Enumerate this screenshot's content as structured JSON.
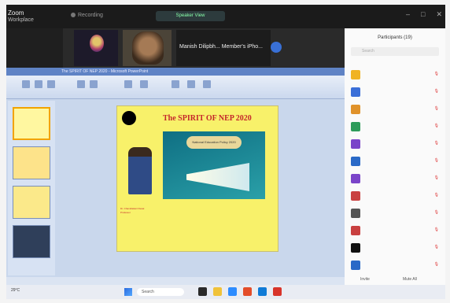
{
  "topbar": {
    "app_line1": "Zoom",
    "app_line2": "Workplace",
    "recording": "Recording",
    "meeting_title": "Speaker View"
  },
  "videos": {
    "tile1_name": "",
    "tile2_name": "",
    "tile3_name": "Manish Dilipbh... Member's iPho..."
  },
  "powerpoint": {
    "titlebar": "The SPIRIT OF NEP 2020 - Microsoft PowerPoint",
    "slide_heading": "The SPIRIT OF NEP 2020",
    "art_label": "National Education Policy 2020",
    "footer_lines": [
      "Dr. Chandrakant Desai",
      "Professor"
    ]
  },
  "participants": {
    "title": "Participants (19)",
    "search_placeholder": "Search",
    "rows": [
      {
        "name": "",
        "color": "#f0b323"
      },
      {
        "name": "",
        "color": "#3b6fd8"
      },
      {
        "name": "",
        "color": "#e0922a"
      },
      {
        "name": "",
        "color": "#2d9b5a"
      },
      {
        "name": "",
        "color": "#7a44c9"
      },
      {
        "name": "",
        "color": "#2a69c7"
      },
      {
        "name": "",
        "color": "#7a44c9"
      },
      {
        "name": "",
        "color": "#c94040"
      },
      {
        "name": "",
        "color": "#555555"
      },
      {
        "name": "",
        "color": "#c94040"
      },
      {
        "name": "",
        "color": "#111111"
      },
      {
        "name": "",
        "color": "#2a69c7"
      }
    ],
    "invite": "Invite",
    "mute_all": "Mute All"
  },
  "taskbar": {
    "weather": "29°C",
    "search": "Search",
    "time": "",
    "date": ""
  }
}
